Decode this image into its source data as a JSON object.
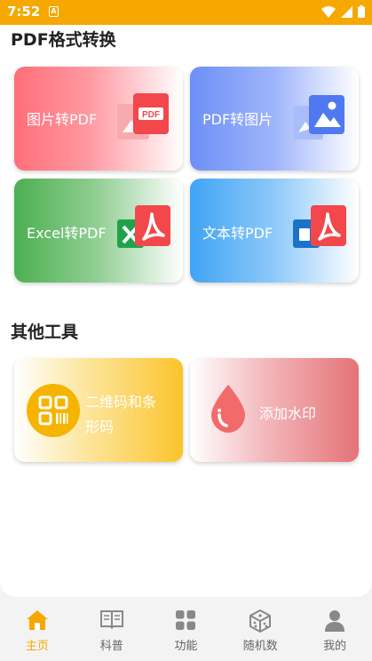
{
  "status_bar": {
    "time": "7:52",
    "notif_letter": "A"
  },
  "sections": {
    "pdf_convert": {
      "title": "PDF格式转换"
    },
    "other_tools": {
      "title": "其他工具"
    }
  },
  "tiles": {
    "image_to_pdf": {
      "label": "图片转PDF",
      "badge": "PDF"
    },
    "pdf_to_image": {
      "label": "PDF转图片"
    },
    "excel_to_pdf": {
      "label": "Excel转PDF"
    },
    "text_to_pdf": {
      "label": "文本转PDF"
    },
    "qrcode": {
      "label_line1": "二维码和条",
      "label_line2": "形码"
    },
    "watermark": {
      "label": "添加水印"
    }
  },
  "bottom_nav": {
    "items": [
      {
        "label": "主页",
        "icon": "home-icon",
        "active": true
      },
      {
        "label": "科普",
        "icon": "book-icon",
        "active": false
      },
      {
        "label": "功能",
        "icon": "grid-icon",
        "active": false
      },
      {
        "label": "随机数",
        "icon": "dice-icon",
        "active": false
      },
      {
        "label": "我的",
        "icon": "user-icon",
        "active": false
      }
    ]
  },
  "colors": {
    "accent": "#f7a800",
    "pdf_red": "#f2474b",
    "image_blue": "#4f79f0",
    "excel_green": "#1fa24a",
    "word_blue": "#1a73c8",
    "qr_yellow": "#f6b400",
    "drop_red": "#f36a6a"
  }
}
